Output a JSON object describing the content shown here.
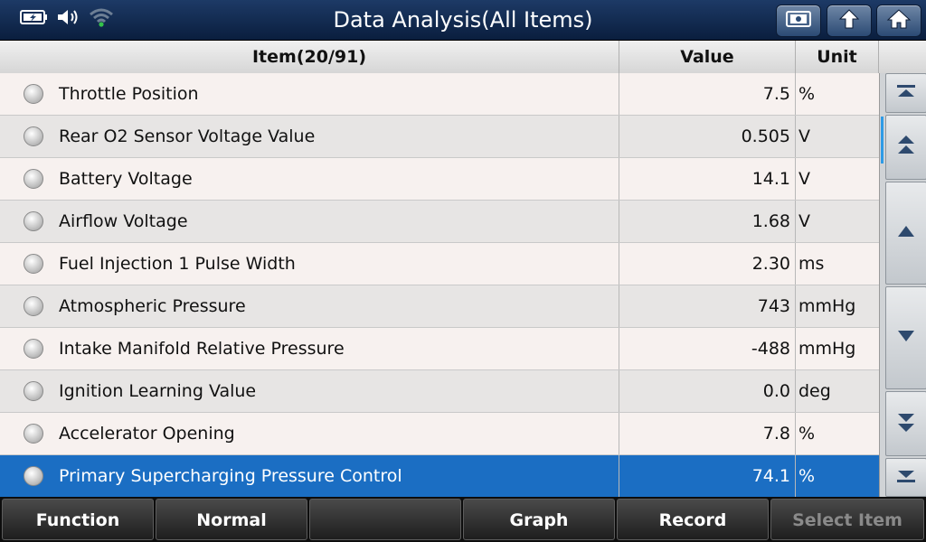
{
  "title": "Data Analysis(All Items)",
  "status_icons": [
    "battery-charging-icon",
    "speaker-icon",
    "wifi-icon"
  ],
  "toolbar": [
    "screenshot-icon",
    "back-icon",
    "home-icon"
  ],
  "columns": {
    "item": "Item(20/91)",
    "value": "Value",
    "unit": "Unit"
  },
  "rows": [
    {
      "name": "Throttle Position",
      "value": "7.5",
      "unit": "%"
    },
    {
      "name": "Rear O2 Sensor Voltage Value",
      "value": "0.505",
      "unit": "V"
    },
    {
      "name": "Battery Voltage",
      "value": "14.1",
      "unit": "V"
    },
    {
      "name": "Airflow Voltage",
      "value": "1.68",
      "unit": "V"
    },
    {
      "name": "Fuel Injection 1 Pulse Width",
      "value": "2.30",
      "unit": "ms"
    },
    {
      "name": "Atmospheric Pressure",
      "value": "743",
      "unit": "mmHg"
    },
    {
      "name": "Intake Manifold Relative Pressure",
      "value": "-488",
      "unit": "mmHg"
    },
    {
      "name": "Ignition Learning Value",
      "value": "0.0",
      "unit": "deg"
    },
    {
      "name": "Accelerator Opening",
      "value": "7.8",
      "unit": "%"
    },
    {
      "name": "Primary Supercharging Pressure Control",
      "value": "74.1",
      "unit": "%",
      "selected": true
    }
  ],
  "scroll_buttons": [
    "scroll-top-icon",
    "page-up-icon",
    "line-up-icon",
    "line-down-icon",
    "page-down-icon",
    "scroll-bottom-icon"
  ],
  "footer": {
    "function": "Function",
    "normal": "Normal",
    "empty": "",
    "graph": "Graph",
    "record": "Record",
    "select_item": "Select Item"
  },
  "colors": {
    "selected_row": "#1b6ec3",
    "title_bar": "#0a1e3e",
    "scroll_indicator": "#2e9be6"
  }
}
